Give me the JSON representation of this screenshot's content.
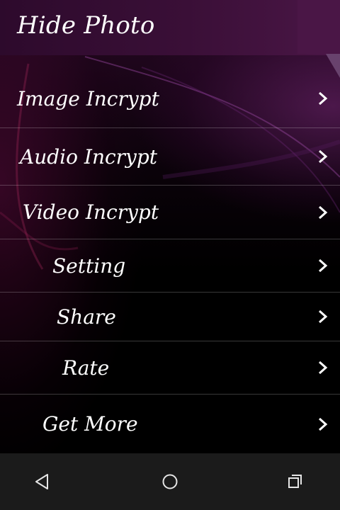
{
  "app": {
    "title": "Hide Photo"
  },
  "menu": {
    "items": [
      {
        "label": "Image Incrypt",
        "icon": "chevron-right-icon"
      },
      {
        "label": "Audio Incrypt",
        "icon": "chevron-right-icon"
      },
      {
        "label": "Video Incrypt",
        "icon": "chevron-right-icon"
      },
      {
        "label": "Setting",
        "icon": "chevron-right-icon"
      },
      {
        "label": "Share",
        "icon": "chevron-right-icon"
      },
      {
        "label": "Rate",
        "icon": "chevron-right-icon"
      },
      {
        "label": "Get More",
        "icon": "chevron-right-icon"
      }
    ]
  },
  "navbar": {
    "back_icon": "back-triangle-icon",
    "home_icon": "home-circle-icon",
    "recents_icon": "recents-square-icon"
  },
  "colors": {
    "header": "#3a0f37",
    "accent_purple": "#7a2a78",
    "navbar": "#1b1b1b",
    "text": "#ffffff"
  }
}
